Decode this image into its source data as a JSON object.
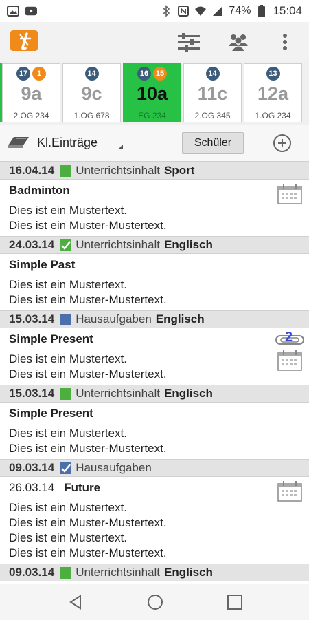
{
  "status_bar": {
    "battery": "74%",
    "time": "15:04",
    "icons": [
      "gallery-icon",
      "youtube-icon",
      "bluetooth-icon",
      "nfc-icon",
      "wifi-icon",
      "signal-icon",
      "battery-icon"
    ]
  },
  "toolbar": {
    "logo_letter": "t",
    "icons": [
      "filter-sliders-icon",
      "people-icon",
      "more-vert-icon"
    ]
  },
  "classes": [
    {
      "name": "9a",
      "room": "2.OG 234",
      "badges": [
        {
          "n": "17",
          "color": "blue"
        },
        {
          "n": "1",
          "color": "orange"
        }
      ],
      "active": false
    },
    {
      "name": "9c",
      "room": "1.OG 678",
      "badges": [
        {
          "n": "14",
          "color": "blue"
        }
      ],
      "active": false
    },
    {
      "name": "10a",
      "room": "EG 234",
      "badges": [
        {
          "n": "16",
          "color": "blue"
        },
        {
          "n": "15",
          "color": "orange"
        }
      ],
      "active": true
    },
    {
      "name": "11c",
      "room": "2.OG 345",
      "badges": [
        {
          "n": "14",
          "color": "blue"
        }
      ],
      "active": false
    },
    {
      "name": "12a",
      "room": "1.OG 234",
      "badges": [
        {
          "n": "13",
          "color": "blue"
        }
      ],
      "active": false
    }
  ],
  "filter": {
    "label": "Kl.Einträge",
    "student_button": "Schüler"
  },
  "entries": [
    {
      "date": "16.04.14",
      "square": "green",
      "checked": false,
      "type": "Unterrichtsinhalt",
      "subject": "Sport",
      "due": "",
      "title": "Badminton",
      "lines": [
        "Dies ist ein Mustertext.",
        "Dies ist ein Muster-Mustertext."
      ],
      "calendar": true,
      "attachments": ""
    },
    {
      "date": "24.03.14",
      "square": "green",
      "checked": true,
      "type": "Unterrichtsinhalt",
      "subject": "Englisch",
      "due": "",
      "title": "Simple Past",
      "lines": [
        "Dies ist ein Mustertext.",
        "Dies ist ein Muster-Mustertext."
      ],
      "calendar": false,
      "attachments": ""
    },
    {
      "date": "15.03.14",
      "square": "blue",
      "checked": false,
      "type": "Hausaufgaben",
      "subject": "Englisch",
      "due": "",
      "title": "Simple Present",
      "lines": [
        "Dies ist ein Mustertext.",
        "Dies ist ein Muster-Mustertext."
      ],
      "calendar": true,
      "attachments": "2"
    },
    {
      "date": "15.03.14",
      "square": "green",
      "checked": false,
      "type": "Unterrichtsinhalt",
      "subject": "Englisch",
      "due": "",
      "title": "Simple Present",
      "lines": [
        "Dies ist ein Mustertext.",
        "Dies ist ein Muster-Mustertext."
      ],
      "calendar": false,
      "attachments": ""
    },
    {
      "date": "09.03.14",
      "square": "blue",
      "checked": true,
      "type": "Hausaufgaben",
      "subject": "",
      "due": "26.03.14",
      "title": "Future",
      "lines": [
        "Dies ist ein Mustertext.",
        "Dies ist ein Muster-Mustertext.",
        "Dies ist ein Mustertext.",
        "Dies ist ein Muster-Mustertext."
      ],
      "calendar": true,
      "attachments": ""
    },
    {
      "date": "09.03.14",
      "square": "green",
      "checked": false,
      "type": "Unterrichtsinhalt",
      "subject": "Englisch",
      "due": "",
      "title": "",
      "lines": [],
      "calendar": false,
      "attachments": ""
    }
  ],
  "nav": {
    "icons": [
      "back-icon",
      "home-icon",
      "recents-icon"
    ]
  },
  "colors": {
    "accent_green": "#27c146",
    "orange": "#f08a1a",
    "badge_blue": "#3d5b7a",
    "homework_blue": "#4b6fa9"
  }
}
